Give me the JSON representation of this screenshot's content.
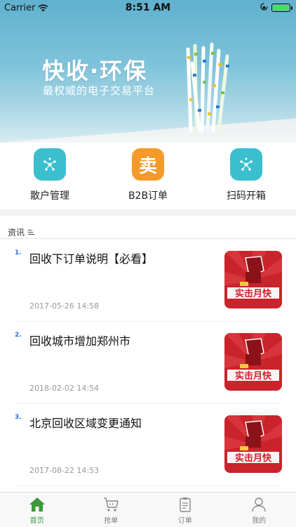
{
  "status_bar": {
    "carrier": "Carrier",
    "time": "8:51 AM"
  },
  "banner": {
    "title": "快收·环保",
    "subtitle": "最权威的电子交易平台"
  },
  "categories": [
    {
      "label": "散户管理",
      "icon": "molecule-icon",
      "color": "#3bbfcf"
    },
    {
      "label": "B2B订单",
      "icon": "sell-icon",
      "glyph": "卖",
      "color": "#f39a2b"
    },
    {
      "label": "扫码开箱",
      "icon": "molecule-icon",
      "color": "#3bbfcf"
    }
  ],
  "news": {
    "header": "资讯",
    "thumb_text": "实击月快",
    "items": [
      {
        "index": "1.",
        "title": "回收下订单说明【必看】",
        "date": "2017-05-26 14:58"
      },
      {
        "index": "2.",
        "title": "回收城市增加郑州市",
        "date": "2018-02-02 14:54"
      },
      {
        "index": "3.",
        "title": "北京回收区域变更通知",
        "date": "2017-08-22 14:53"
      }
    ]
  },
  "tabs": [
    {
      "label": "首页",
      "icon": "home-icon",
      "active": true
    },
    {
      "label": "抢单",
      "icon": "cart-icon",
      "active": false
    },
    {
      "label": "订单",
      "icon": "clipboard-icon",
      "active": false
    },
    {
      "label": "我的",
      "icon": "user-icon",
      "active": false
    }
  ],
  "colors": {
    "accent": "#3c9a3a",
    "teal": "#3bbfcf",
    "orange": "#f39a2b",
    "link_blue": "#2a6cd6"
  }
}
